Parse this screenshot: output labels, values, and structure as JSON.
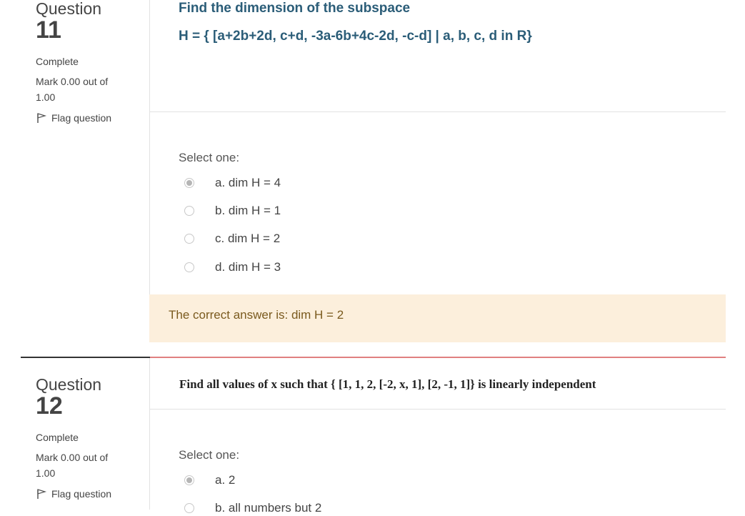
{
  "q11": {
    "label": "Question",
    "number": "11",
    "state": "Complete",
    "mark": "Mark 0.00 out of",
    "mark_total": "1.00",
    "flag": "Flag question",
    "title": "Find the dimension of the subspace",
    "definition": "H = { [a+2b+2d, c+d, -3a-6b+4c-2d, -c-d] | a, b, c, d in R}",
    "select_one": "Select one:",
    "options": [
      {
        "label": "a. dim H = 4",
        "checked": true
      },
      {
        "label": "b. dim H = 1",
        "checked": false
      },
      {
        "label": "c. dim H = 2",
        "checked": false
      },
      {
        "label": "d. dim H = 3",
        "checked": false
      }
    ],
    "feedback": "The correct answer is: dim H = 2"
  },
  "q12": {
    "label": "Question",
    "number": "12",
    "state": "Complete",
    "mark": "Mark 0.00 out of",
    "mark_total": "1.00",
    "flag": "Flag question",
    "text": "Find all values of x such that { [1, 1, 2, [-2, x, 1], [2, -1, 1]} is linearly independent",
    "select_one": "Select one:",
    "options": [
      {
        "label": "a. 2",
        "checked": true
      },
      {
        "label": "b. all numbers but 2",
        "checked": false
      }
    ]
  },
  "colors": {
    "accent": "#2b5d78",
    "feedback_bg": "#fcefdc",
    "separator_red": "#e08080"
  }
}
